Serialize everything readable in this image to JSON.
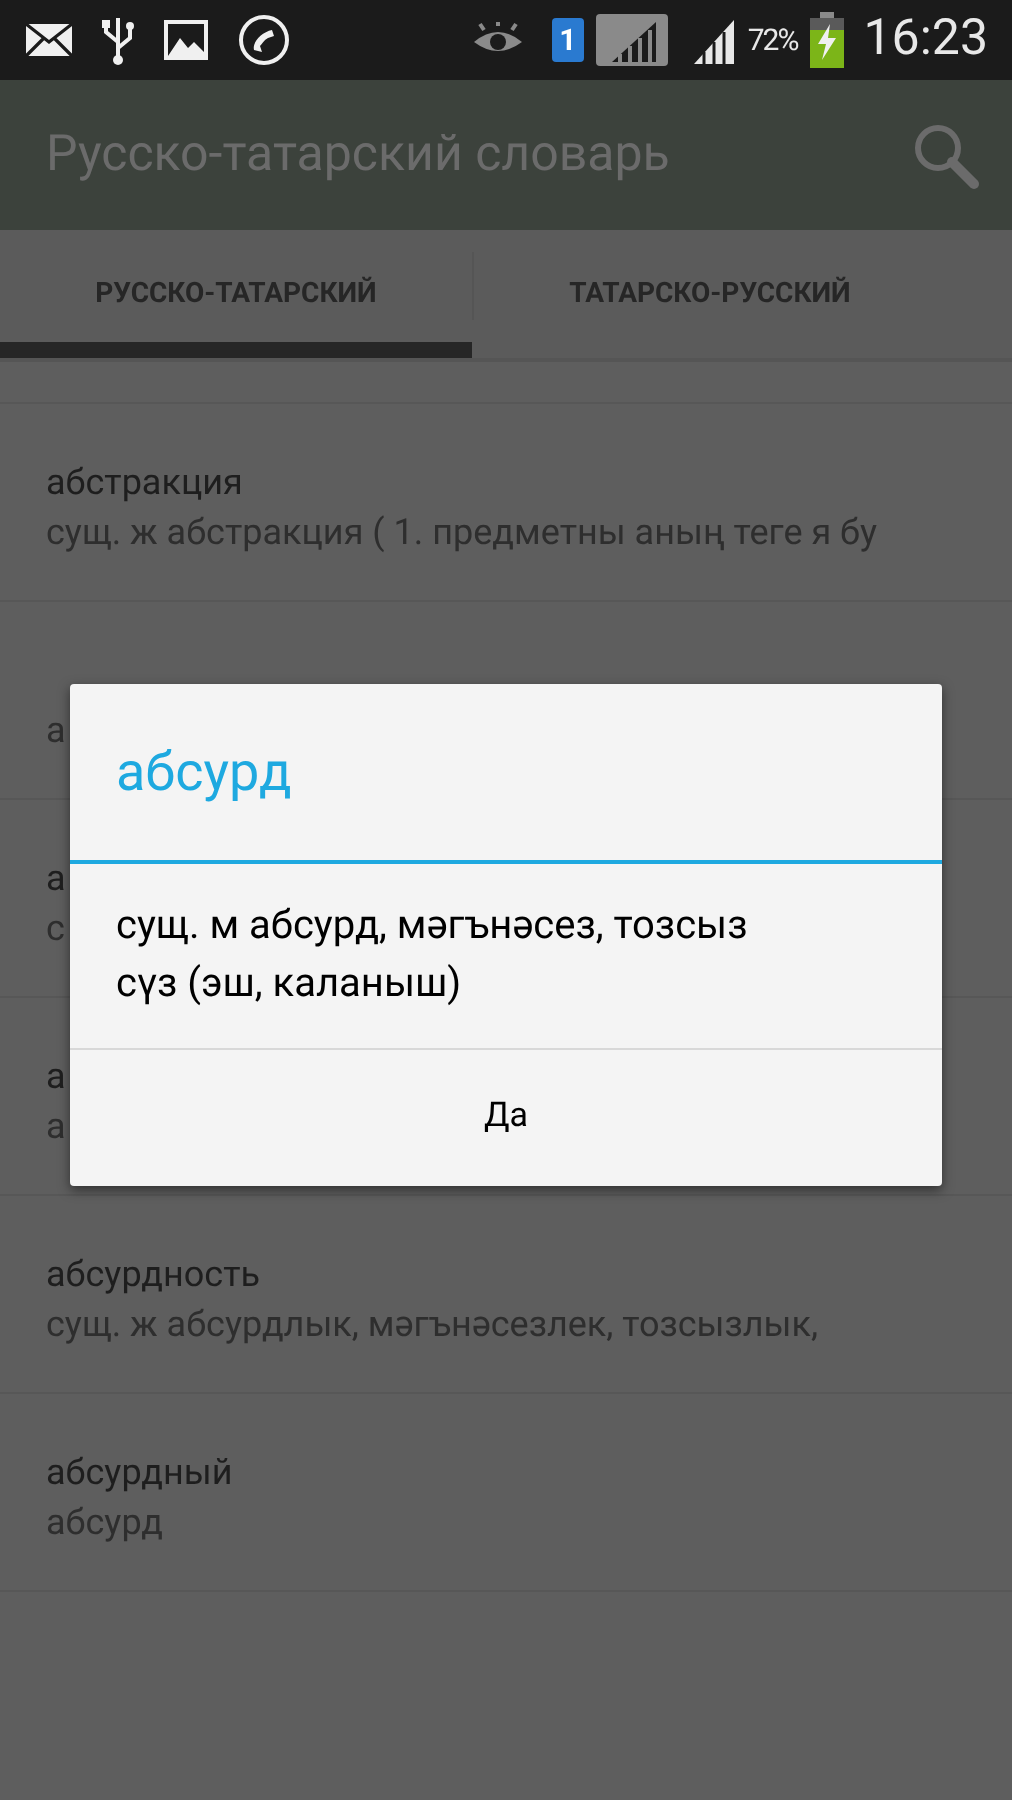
{
  "status_bar": {
    "sim": "1",
    "battery": "72%",
    "time": "16:23"
  },
  "app_bar": {
    "title": "Русско-татарский словарь"
  },
  "tabs": [
    {
      "label": "РУССКО-ТАТАРСКИЙ",
      "selected": true
    },
    {
      "label": "ТАТАРСКО-РУССКИЙ",
      "selected": false
    }
  ],
  "entries": [
    {
      "word": "абстракция",
      "meaning": "сущ. ж абстракция ( 1. предметны аның теге я бу"
    },
    {
      "meaning": "а"
    },
    {
      "word": "а",
      "meaning": "с"
    },
    {
      "word": "а",
      "meaning": "а"
    },
    {
      "word": "абсурдность",
      "meaning": "сущ. ж абсурдлык, мәгънәсезлек, тозсызлык,"
    },
    {
      "word": "абсурдный",
      "meaning": "абсурд"
    }
  ],
  "dialog": {
    "title": "абсурд",
    "body": "сущ. м абсурд, мәгънәсез, тозсыз сүз (эш, каланыш)",
    "button": "Да"
  }
}
